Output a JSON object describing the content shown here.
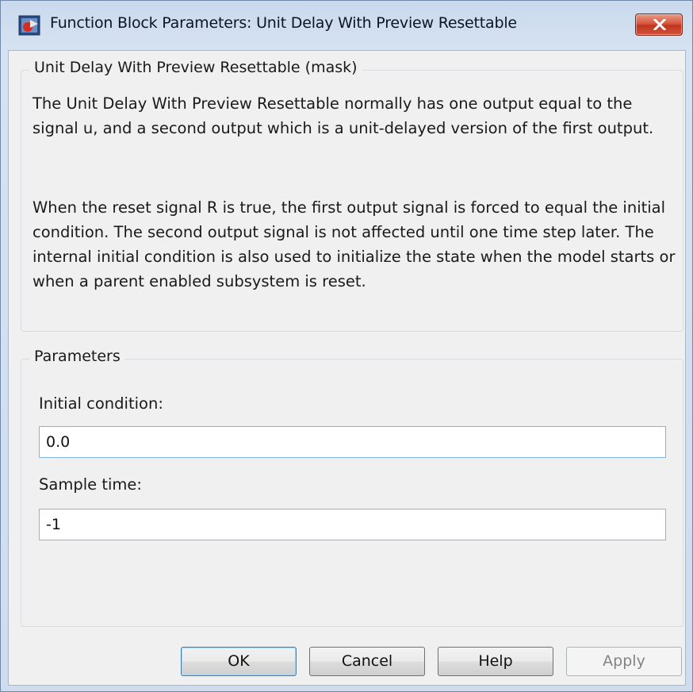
{
  "window": {
    "title": "Function Block Parameters: Unit Delay With Preview Resettable",
    "close_icon": "close-icon"
  },
  "mask_group": {
    "legend": "Unit Delay With Preview Resettable (mask)",
    "paragraphs": [
      "The Unit Delay With Preview Resettable normally has one output equal to the signal u, and a second output which is a unit-delayed version of the first output.",
      "When the reset signal R is true, the first output signal is forced to equal the initial condition.  The second output signal is not affected until one time step later.  The internal initial condition is also used to initialize the state when the model starts or when a parent enabled subsystem is reset."
    ]
  },
  "parameters": {
    "legend": "Parameters",
    "fields": [
      {
        "label": "Initial condition:",
        "value": "0.0"
      },
      {
        "label": "Sample time:",
        "value": "-1"
      }
    ]
  },
  "buttons": {
    "ok": "OK",
    "cancel": "Cancel",
    "help": "Help",
    "apply": "Apply"
  },
  "colors": {
    "close_button": "#c9452d",
    "default_button_border": "#3c7fb1"
  }
}
